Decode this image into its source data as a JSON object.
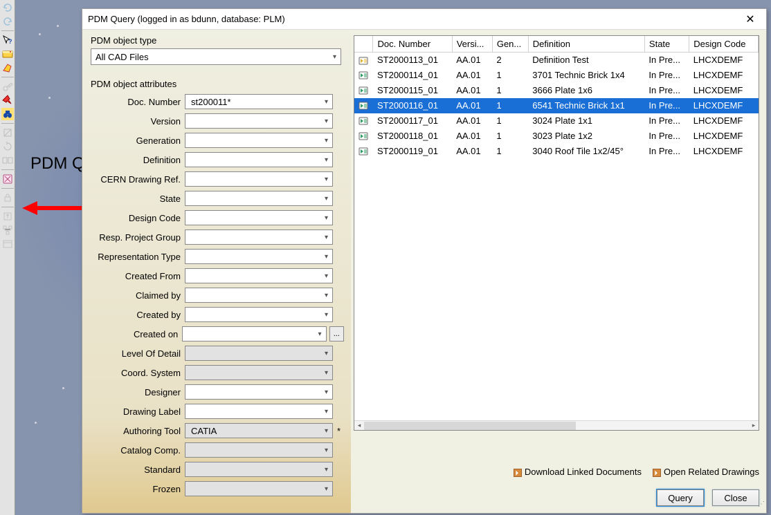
{
  "callout_label": "PDM Query",
  "dialog": {
    "title": "PDM Query (logged in as bdunn, database: PLM)",
    "close_glyph": "✕",
    "pdm_object_type_label": "PDM object type",
    "pdm_object_type_value": "All CAD Files",
    "attributes_label": "PDM object attributes",
    "attributes": [
      {
        "label": "Doc. Number",
        "value": "st200011*",
        "grey": false
      },
      {
        "label": "Version",
        "value": "",
        "grey": false
      },
      {
        "label": "Generation",
        "value": "",
        "grey": false
      },
      {
        "label": "Definition",
        "value": "",
        "grey": false
      },
      {
        "label": "CERN Drawing Ref.",
        "value": "",
        "grey": false
      },
      {
        "label": "State",
        "value": "",
        "grey": false
      },
      {
        "label": "Design Code",
        "value": "",
        "grey": false
      },
      {
        "label": "Resp. Project Group",
        "value": "",
        "grey": false
      },
      {
        "label": "Representation Type",
        "value": "",
        "grey": false
      },
      {
        "label": "Created From",
        "value": "",
        "grey": false
      },
      {
        "label": "Claimed by",
        "value": "",
        "grey": false
      },
      {
        "label": "Created by",
        "value": "",
        "grey": false
      },
      {
        "label": "Created on",
        "value": "",
        "grey": false,
        "extra": "..."
      },
      {
        "label": "Level Of Detail",
        "value": "",
        "grey": true
      },
      {
        "label": "Coord. System",
        "value": "",
        "grey": true
      },
      {
        "label": "Designer",
        "value": "",
        "grey": false
      },
      {
        "label": "Drawing Label",
        "value": "",
        "grey": false
      },
      {
        "label": "Authoring Tool",
        "value": "CATIA",
        "grey": true,
        "star": "*"
      },
      {
        "label": "Catalog Comp.",
        "value": "",
        "grey": true
      },
      {
        "label": "Standard",
        "value": "",
        "grey": true
      },
      {
        "label": "Frozen",
        "value": "",
        "grey": true
      }
    ],
    "columns": [
      "",
      "Doc. Number",
      "Versi...",
      "Gen...",
      "Definition",
      "State",
      "Design Code"
    ],
    "rows": [
      {
        "icon": "cad-yellow",
        "doc": "ST2000113_01",
        "ver": "AA.01",
        "gen": "2",
        "def": "Definition Test",
        "state": "In Pre...",
        "code": "LHCXDEMF",
        "sel": false
      },
      {
        "icon": "cad-green",
        "doc": "ST2000114_01",
        "ver": "AA.01",
        "gen": "1",
        "def": "3701 Technic Brick 1x4",
        "state": "In Pre...",
        "code": "LHCXDEMF",
        "sel": false
      },
      {
        "icon": "cad-green",
        "doc": "ST2000115_01",
        "ver": "AA.01",
        "gen": "1",
        "def": "3666 Plate 1x6",
        "state": "In Pre...",
        "code": "LHCXDEMF",
        "sel": false
      },
      {
        "icon": "cad-green",
        "doc": "ST2000116_01",
        "ver": "AA.01",
        "gen": "1",
        "def": "6541 Technic Brick 1x1",
        "state": "In Pre...",
        "code": "LHCXDEMF",
        "sel": true
      },
      {
        "icon": "cad-green",
        "doc": "ST2000117_01",
        "ver": "AA.01",
        "gen": "1",
        "def": "3024 Plate 1x1",
        "state": "In Pre...",
        "code": "LHCXDEMF",
        "sel": false
      },
      {
        "icon": "cad-green",
        "doc": "ST2000118_01",
        "ver": "AA.01",
        "gen": "1",
        "def": "3023 Plate 1x2",
        "state": "In Pre...",
        "code": "LHCXDEMF",
        "sel": false
      },
      {
        "icon": "cad-green",
        "doc": "ST2000119_01",
        "ver": "AA.01",
        "gen": "1",
        "def": "3040 Roof Tile 1x2/45°",
        "state": "In Pre...",
        "code": "LHCXDEMF",
        "sel": false
      }
    ],
    "download_label": "Download Linked Documents",
    "openrel_label": "Open Related Drawings",
    "query_label": "Query",
    "close_label": "Close"
  }
}
